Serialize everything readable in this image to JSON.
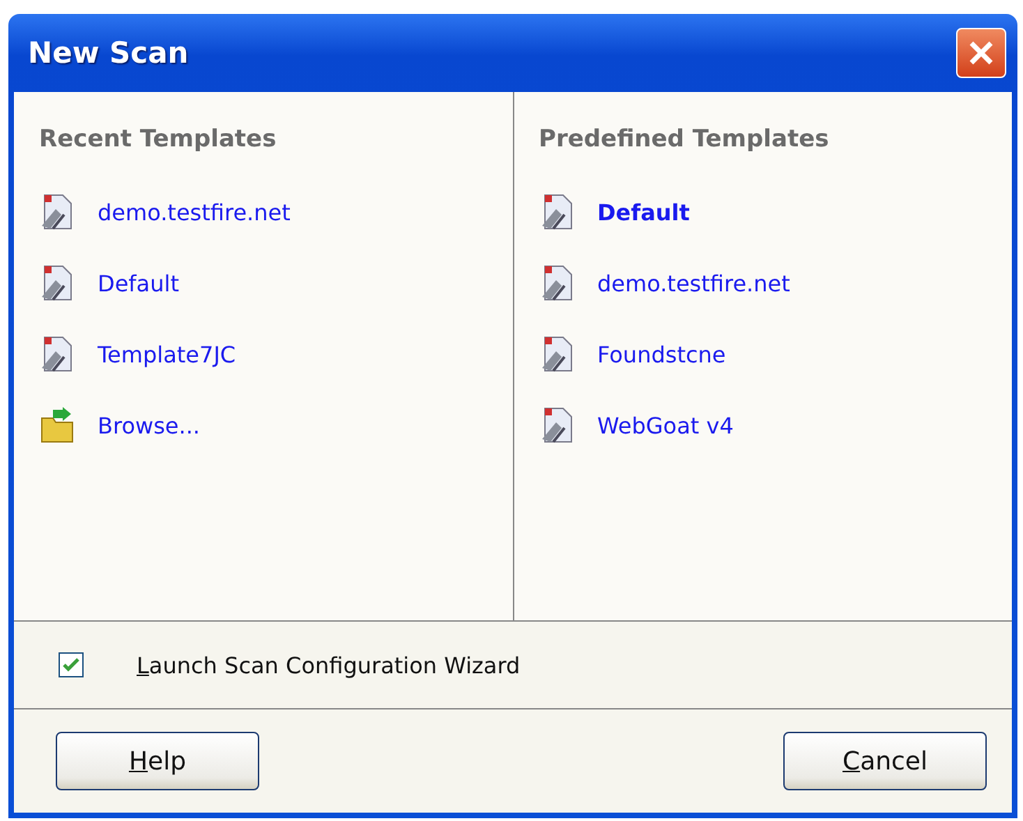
{
  "window": {
    "title": "New Scan"
  },
  "columns": [
    {
      "heading": "Recent Templates",
      "items": [
        {
          "label": "demo.testfire.net",
          "kind": "template",
          "selected": false
        },
        {
          "label": "Default",
          "kind": "template",
          "selected": false
        },
        {
          "label": "Template7JC",
          "kind": "template",
          "selected": false
        },
        {
          "label": "Browse...",
          "kind": "folder",
          "selected": false
        }
      ]
    },
    {
      "heading": "Predefined Templates",
      "items": [
        {
          "label": "Default",
          "kind": "template",
          "selected": true
        },
        {
          "label": "demo.testfire.net",
          "kind": "template",
          "selected": false
        },
        {
          "label": "Foundstcne",
          "kind": "template",
          "selected": false
        },
        {
          "label": "WebGoat v4",
          "kind": "template",
          "selected": false
        }
      ]
    }
  ],
  "wizard_option": {
    "label": "Launch Scan Configuration Wizard",
    "checked": true,
    "access_key_underlined": true
  },
  "buttons": [
    {
      "label": "Help",
      "access_key_underlined": true
    },
    {
      "label": "Cancel",
      "access_key_underlined": true
    }
  ]
}
